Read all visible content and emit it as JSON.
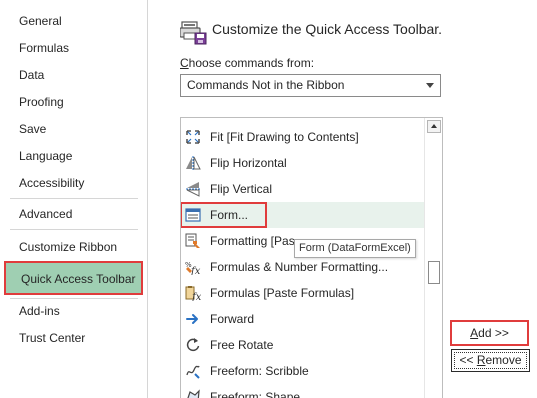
{
  "nav": {
    "items": [
      {
        "label": "General"
      },
      {
        "label": "Formulas"
      },
      {
        "label": "Data"
      },
      {
        "label": "Proofing"
      },
      {
        "label": "Save"
      },
      {
        "label": "Language"
      },
      {
        "label": "Accessibility"
      },
      {
        "label": "Advanced"
      },
      {
        "label": "Customize Ribbon"
      },
      {
        "label": "Quick Access Toolbar"
      },
      {
        "label": "Add-ins"
      },
      {
        "label": "Trust Center"
      }
    ],
    "active": "Quick Access Toolbar"
  },
  "header": {
    "title": "Customize the Quick Access Toolbar.",
    "icon": "qat-customize-icon"
  },
  "choose": {
    "label_prefix": "C",
    "label_rest": "hoose commands from:",
    "selected": "Commands Not in the Ribbon"
  },
  "commands": [
    {
      "label": "Fit [Fit Drawing to Contents]",
      "icon": "fit-drawing-icon"
    },
    {
      "label": "Flip Horizontal",
      "icon": "flip-horizontal-icon"
    },
    {
      "label": "Flip Vertical",
      "icon": "flip-vertical-icon"
    },
    {
      "label": "Form...",
      "icon": "form-icon"
    },
    {
      "label": "Formatting [Pas",
      "icon": "formatting-icon"
    },
    {
      "label": "Formulas & Number Formatting...",
      "icon": "formulas-number-formatting-icon"
    },
    {
      "label": "Formulas [Paste Formulas]",
      "icon": "paste-formulas-icon"
    },
    {
      "label": "Forward",
      "icon": "forward-arrow-icon"
    },
    {
      "label": "Free Rotate",
      "icon": "free-rotate-icon"
    },
    {
      "label": "Freeform: Scribble",
      "icon": "freeform-scribble-icon"
    },
    {
      "label": "Freeform: Shape",
      "icon": "freeform-shape-icon"
    }
  ],
  "tooltip": "Form (DataFormExcel)",
  "buttons": {
    "add_prefix": "A",
    "add_rest": "dd >>",
    "remove_prefix": "<< ",
    "remove_u": "R",
    "remove_rest": "emove"
  },
  "colors": {
    "highlight_border": "#e03c3c",
    "active_nav": "#9fcfb2",
    "hover_row": "#e8f2ec"
  }
}
